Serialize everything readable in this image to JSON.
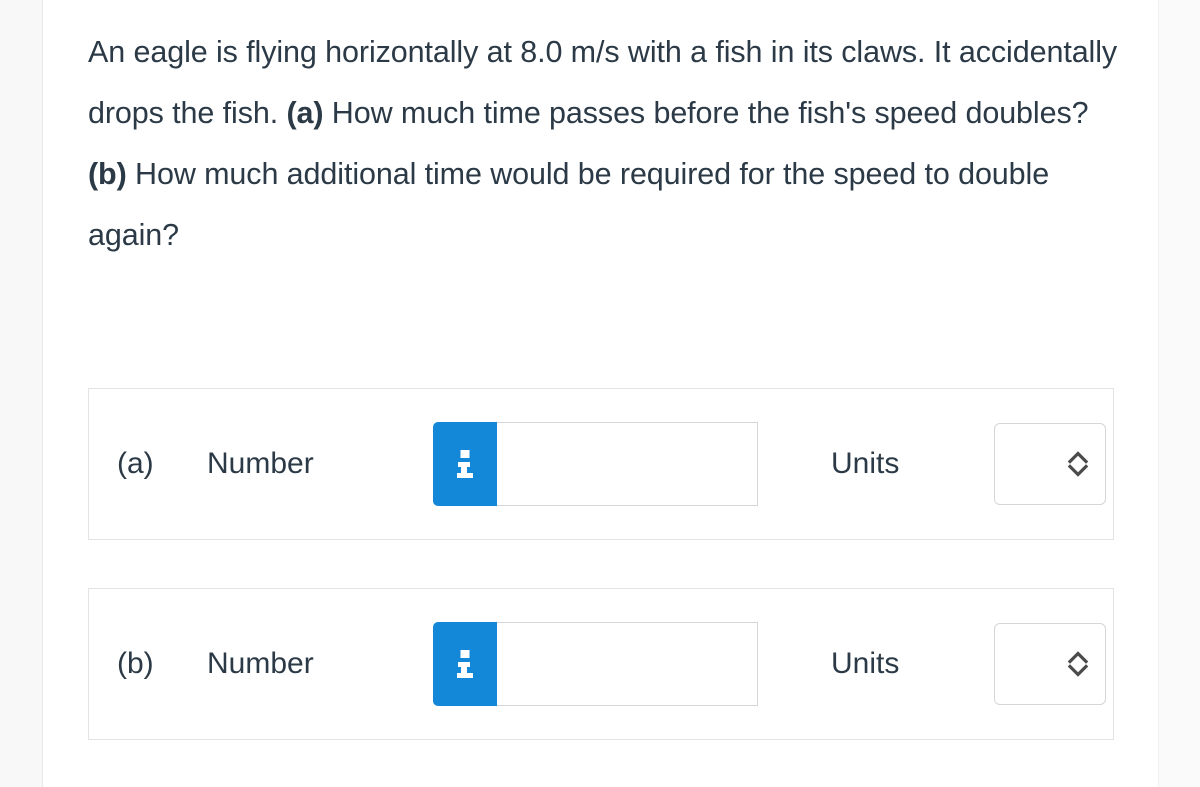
{
  "question": {
    "segments": [
      {
        "text": "An eagle is flying horizontally at 8.0 m/s with a fish in its claws. It accidentally drops the fish. ",
        "bold": false
      },
      {
        "text": "(a)",
        "bold": true
      },
      {
        "text": " How much time passes before the fish's speed doubles? ",
        "bold": false
      },
      {
        "text": "(b)",
        "bold": true
      },
      {
        "text": " How much additional time would be required for the speed to double again?",
        "bold": false
      }
    ],
    "plain_text": "An eagle is flying horizontally at 8.0 m/s with a fish in its claws. It accidentally drops the fish. (a) How much time passes before the fish's speed doubles? (b) How much additional time would be required for the speed to double again?"
  },
  "answers": [
    {
      "part_label": "(a)",
      "number_label": "Number",
      "info_icon": "info-icon",
      "number_value": "",
      "number_placeholder": "",
      "units_label": "Units",
      "units_value": "",
      "units_icon": "up-down-chevron-icon"
    },
    {
      "part_label": "(b)",
      "number_label": "Number",
      "info_icon": "info-icon",
      "number_value": "",
      "number_placeholder": "",
      "units_label": "Units",
      "units_value": "",
      "units_icon": "up-down-chevron-icon"
    }
  ],
  "colors": {
    "text": "#2b3a46",
    "info_button_blue": "#1387d8",
    "card_border": "#e3e3e5",
    "field_border": "#d6d6d8",
    "gutter_background": "#f8f8f9",
    "page_background": "#ffffff"
  }
}
